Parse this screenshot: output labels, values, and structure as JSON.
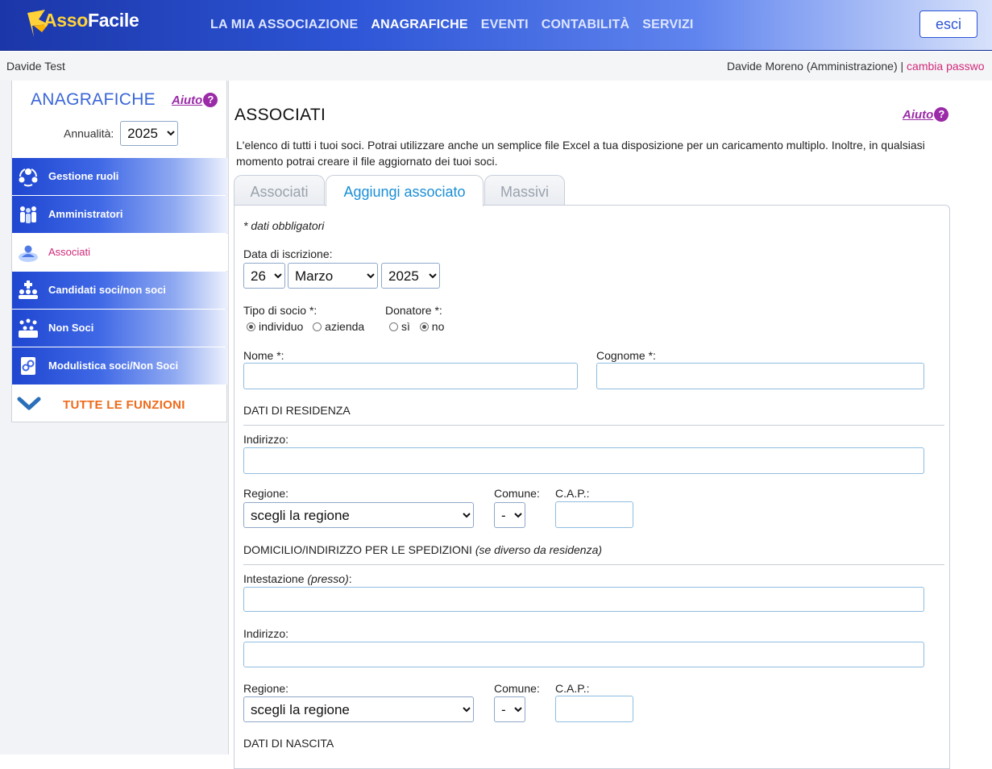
{
  "header": {
    "logo_prefix": "Asso",
    "logo_suffix": "Facile",
    "nav": [
      "LA MIA ASSOCIAZIONE",
      "ANAGRAFICHE",
      "EVENTI",
      "CONTABILITÀ",
      "SERVIZI"
    ],
    "active_nav": 1,
    "logout_label": "esci"
  },
  "userbar": {
    "left": "Davide Test",
    "user": "Davide Moreno (Amministrazione) | ",
    "change_password": "cambia passwo"
  },
  "sidebar": {
    "title": "ANAGRAFICHE",
    "help": "Aiuto",
    "help_mark": "?",
    "year_label": "Annualità:",
    "year_value": "2025",
    "items": [
      {
        "label": "Gestione ruoli",
        "icon": "roles-icon"
      },
      {
        "label": "Amministratori",
        "icon": "admins-icon"
      },
      {
        "label": "Associati",
        "icon": "member-icon"
      },
      {
        "label": "Candidati soci/non soci",
        "icon": "candidates-icon"
      },
      {
        "label": "Non Soci",
        "icon": "non-members-icon"
      },
      {
        "label": "Modulistica soci/Non Soci",
        "icon": "forms-icon"
      }
    ],
    "active_item": 2,
    "all_functions": "TUTTE LE FUNZIONI"
  },
  "content": {
    "title": "ASSOCIATI",
    "help": "Aiuto",
    "help_mark": "?",
    "intro": "L'elenco di tutti i tuoi soci. Potrai utilizzare anche un semplice file Excel a tua disposizione per un caricamento multiplo. Inoltre, in qualsiasi momento potrai creare il file aggiornato dei tuoi soci.",
    "tabs": [
      "Associati",
      "Aggiungi associato",
      "Massivi"
    ],
    "active_tab": 1
  },
  "form": {
    "required_note": "* dati obbligatori",
    "date_label": "Data di iscrizione:",
    "day": "26",
    "month": "Marzo",
    "year": "2025",
    "member_type_label": "Tipo di socio *:",
    "member_type_options": [
      "individuo",
      "azienda"
    ],
    "donor_label": "Donatore *:",
    "donor_options": [
      "sì",
      "no"
    ],
    "name_label": "Nome *:",
    "surname_label": "Cognome *:",
    "residence_section": "DATI DI RESIDENZA",
    "address_label": "Indirizzo:",
    "region_label": "Regione:",
    "region_placeholder": "scegli la regione",
    "city_label": "Comune:",
    "city_value": "-",
    "zip_label": "C.A.P.:",
    "shipping_section": "DOMICILIO/INDIRIZZO PER LE SPEDIZIONI",
    "shipping_note": "(se diverso da residenza)",
    "care_of_label": "Intestazione",
    "care_of_note": "(presso)",
    "care_of_colon": ":",
    "birth_section": "DATI DI NASCITA"
  }
}
